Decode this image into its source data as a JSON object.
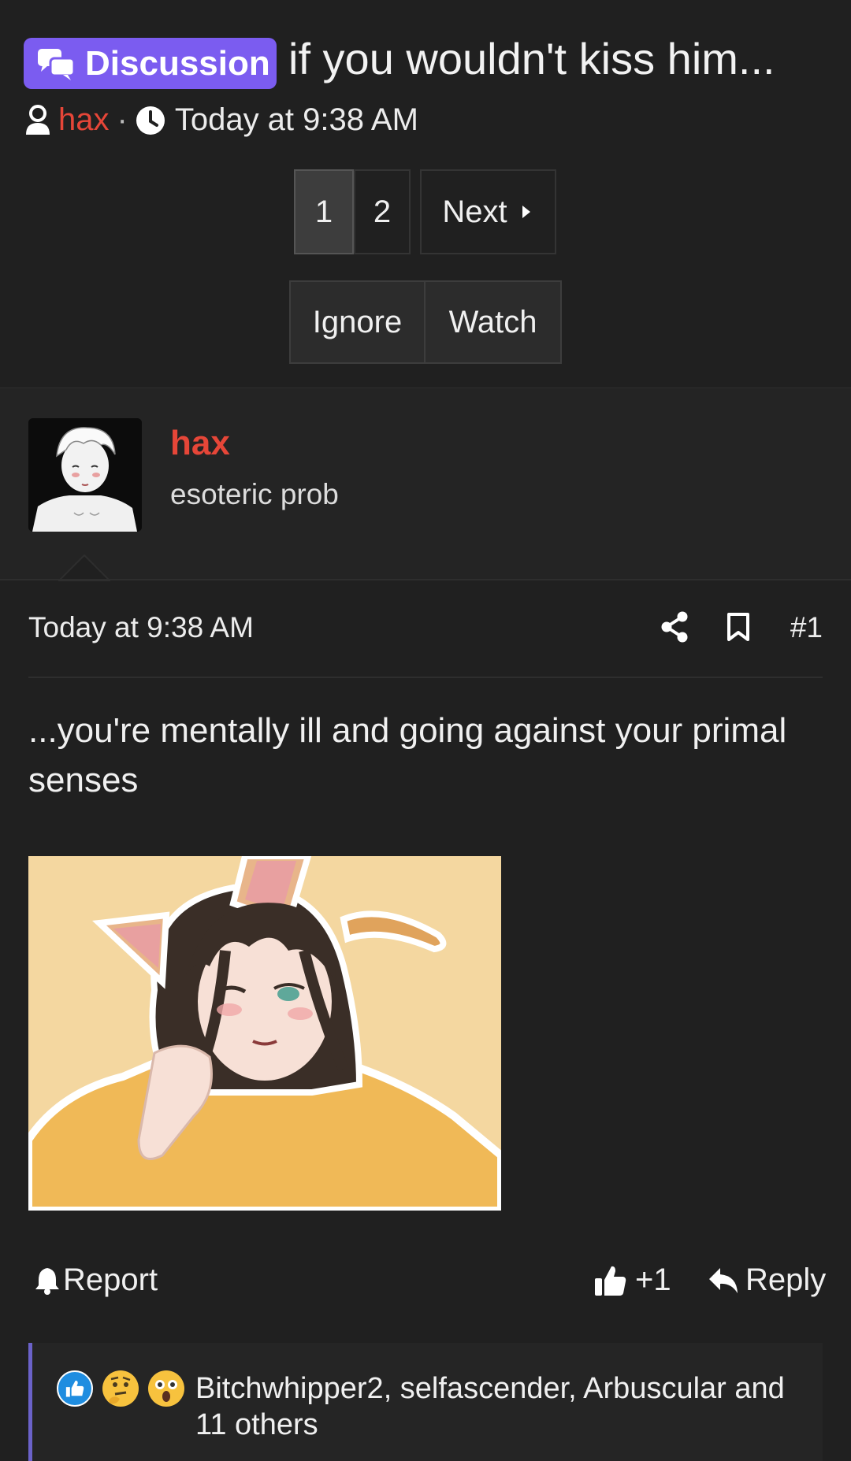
{
  "thread": {
    "prefix": "Discussion",
    "title": "if you wouldn't kiss him...",
    "author": "hax",
    "separator": "·",
    "date": "Today at 9:38 AM"
  },
  "pagination": {
    "pages": [
      "1",
      "2"
    ],
    "current": "1",
    "next_label": "Next"
  },
  "thread_actions": {
    "ignore_label": "Ignore",
    "watch_label": "Watch"
  },
  "post": {
    "username": "hax",
    "user_title": "esoteric prob",
    "date": "Today at 9:38 AM",
    "number": "#1",
    "body": "...you're mentally ill and going against your primal senses",
    "report_label": "Report",
    "plus_one_label": "+1",
    "reply_label": "Reply",
    "reactions_text": "Bitchwhipper2, selfascender, Arbuscular and 11 others"
  },
  "colors": {
    "background": "#202020",
    "prefix_purple": "#7b5cf0",
    "username_red": "#e64638",
    "reaction_border": "#6b62c9"
  },
  "icons": [
    "comments-icon",
    "user-icon",
    "clock-icon",
    "caret-right-icon",
    "share-icon",
    "bookmark-icon",
    "bell-icon",
    "thumbs-up-icon",
    "reply-icon",
    "like-reaction-icon",
    "thinking-reaction-icon",
    "wow-reaction-icon"
  ]
}
